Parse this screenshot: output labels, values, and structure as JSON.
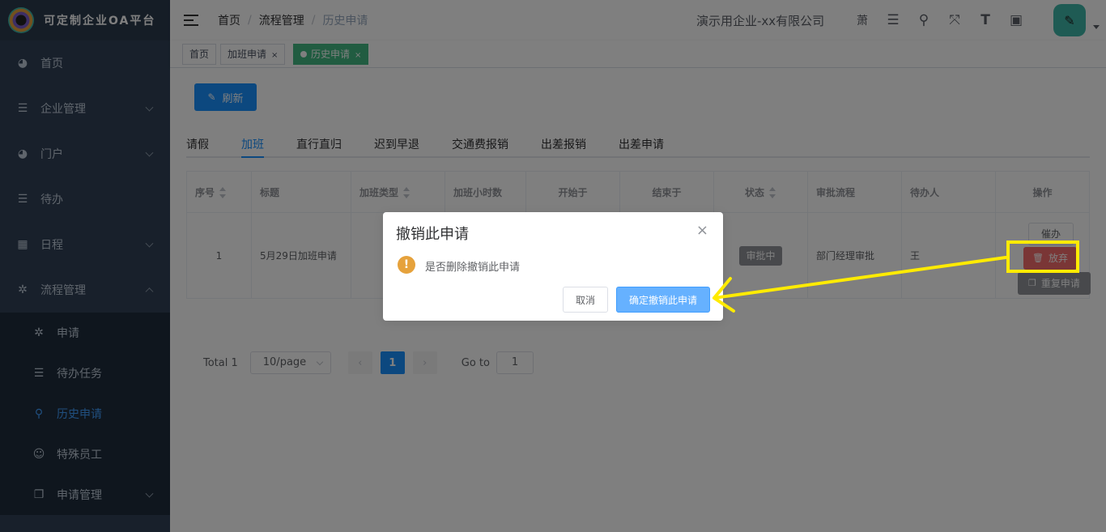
{
  "app": {
    "title": "可定制企业OA平台"
  },
  "sidebar": {
    "items": [
      {
        "label": "首页",
        "icon": "dashboard-icon"
      },
      {
        "label": "企业管理",
        "icon": "list-icon"
      },
      {
        "label": "门户",
        "icon": "dashboard-icon"
      },
      {
        "label": "待办",
        "icon": "list-icon"
      },
      {
        "label": "日程",
        "icon": "grid-icon"
      },
      {
        "label": "流程管理",
        "icon": "gear-icon"
      }
    ],
    "subitems": [
      {
        "label": "申请",
        "icon": "gear-icon"
      },
      {
        "label": "待办任务",
        "icon": "list-icon"
      },
      {
        "label": "历史申请",
        "icon": "search-icon"
      },
      {
        "label": "特殊员工",
        "icon": "user-icon"
      },
      {
        "label": "申请管理",
        "icon": "copy-icon"
      }
    ]
  },
  "navbar": {
    "breadcrumb": [
      "首页",
      "流程管理",
      "历史申请"
    ],
    "company": "演示用企业-xx有限公司",
    "extra_char": "萧"
  },
  "tagsview": {
    "tags": [
      {
        "label": "首页"
      },
      {
        "label": "加班申请",
        "close": "×"
      },
      {
        "label": "历史申请",
        "close": "×"
      }
    ]
  },
  "toolbar": {
    "refresh_label": "刷新"
  },
  "tabs": [
    "请假",
    "加班",
    "直行直归",
    "迟到早退",
    "交通费报销",
    "出差报销",
    "出差申请"
  ],
  "table": {
    "headers": [
      "序号",
      "标题",
      "加班类型",
      "加班小时数",
      "开始于",
      "结束于",
      "状态",
      "审批流程",
      "待办人",
      "操作"
    ],
    "row": {
      "index": "1",
      "title": "5月29日加班申请",
      "status": "审批中",
      "flow": "部门经理审批",
      "assignee": "王"
    },
    "ops": {
      "urge": "催办",
      "abandon": "放弃",
      "reapply": "重复申请"
    }
  },
  "pagination": {
    "total": "Total 1",
    "page_size": "10/page",
    "current_page": "1",
    "goto_label": "Go to",
    "goto_value": "1"
  },
  "dialog": {
    "title": "撤销此申请",
    "close": "×",
    "message": "是否删除撤销此申请",
    "cancel": "取消",
    "confirm": "确定撤销此申请"
  },
  "colors": {
    "sidebar_bg": "#304156",
    "primary": "#1890ff",
    "active_tag": "#42b983",
    "danger": "#f56c6c",
    "annotation": "#ffeb00"
  }
}
